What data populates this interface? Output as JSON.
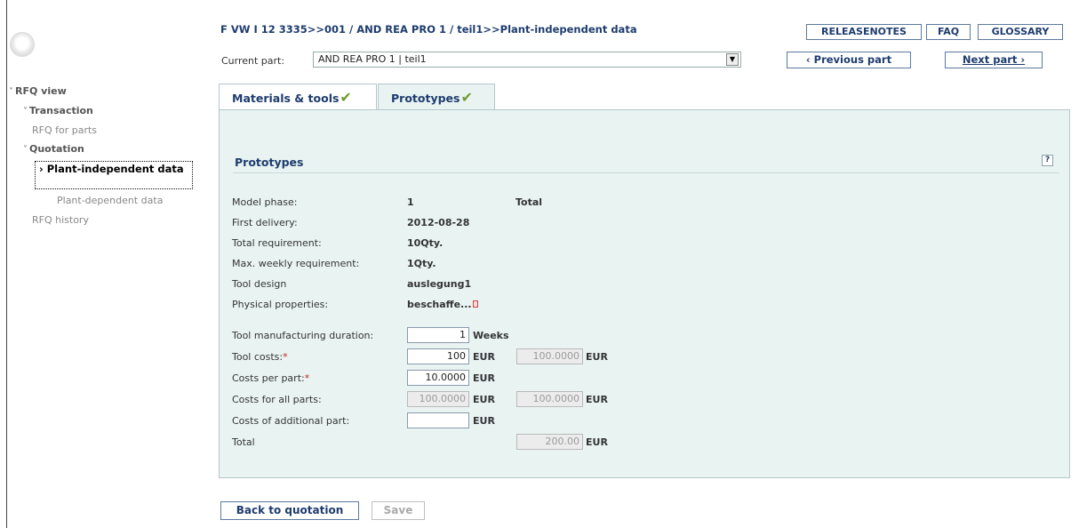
{
  "header": {
    "breadcrumb": "F VW I 12 3335>>001 / AND REA PRO 1 / teil1>>Plant-independent data",
    "buttons": {
      "releasenotes": "RELEASENOTES",
      "faq": "FAQ",
      "glossary": "GLOSSARY"
    },
    "current_part_label": "Current part:",
    "current_part_value": "AND REA PRO 1 | teil1",
    "previous_part": "‹ Previous part",
    "next_part": "Next part ›"
  },
  "sidebar": {
    "rfq_view": "RFQ view",
    "transaction": "Transaction",
    "rfq_for_parts": "RFQ for parts",
    "quotation": "Quotation",
    "active_item": "Plant-independent data",
    "plant_dependent": "Plant-dependent data",
    "rfq_history": "RFQ history"
  },
  "tabs": [
    {
      "label": "Materials & tools"
    },
    {
      "label": "Prototypes"
    }
  ],
  "section": {
    "title": "Prototypes",
    "help": "?"
  },
  "form": {
    "model_phase": {
      "label": "Model phase:",
      "value": "1",
      "extra": "Total"
    },
    "first_delivery": {
      "label": "First delivery:",
      "value": "2012-08-28"
    },
    "total_requirement": {
      "label": "Total requirement:",
      "value": "10Qty."
    },
    "max_weekly": {
      "label": "Max. weekly requirement:",
      "value": "1Qty."
    },
    "tool_design": {
      "label": "Tool design",
      "value": "auslegung1"
    },
    "physical": {
      "label": "Physical properties:",
      "value": "beschaffe..."
    },
    "duration": {
      "label": "Tool manufacturing duration:",
      "value": "1",
      "unit": "Weeks"
    },
    "tool_costs": {
      "label": "Tool costs:",
      "required": "*",
      "value": "100",
      "unit": "EUR",
      "total": "100.0000",
      "total_unit": "EUR"
    },
    "costs_per_part": {
      "label": "Costs per part:",
      "required": "*",
      "value": "10.0000",
      "unit": "EUR"
    },
    "costs_all_parts": {
      "label": "Costs for all parts:",
      "value": "100.0000",
      "unit": "EUR",
      "total": "100.0000",
      "total_unit": "EUR"
    },
    "costs_additional": {
      "label": "Costs of additional part:",
      "value": "",
      "unit": "EUR"
    },
    "total": {
      "label": "Total",
      "value": "200.00",
      "unit": "EUR"
    }
  },
  "footer": {
    "back": "Back to quotation",
    "save": "Save"
  }
}
